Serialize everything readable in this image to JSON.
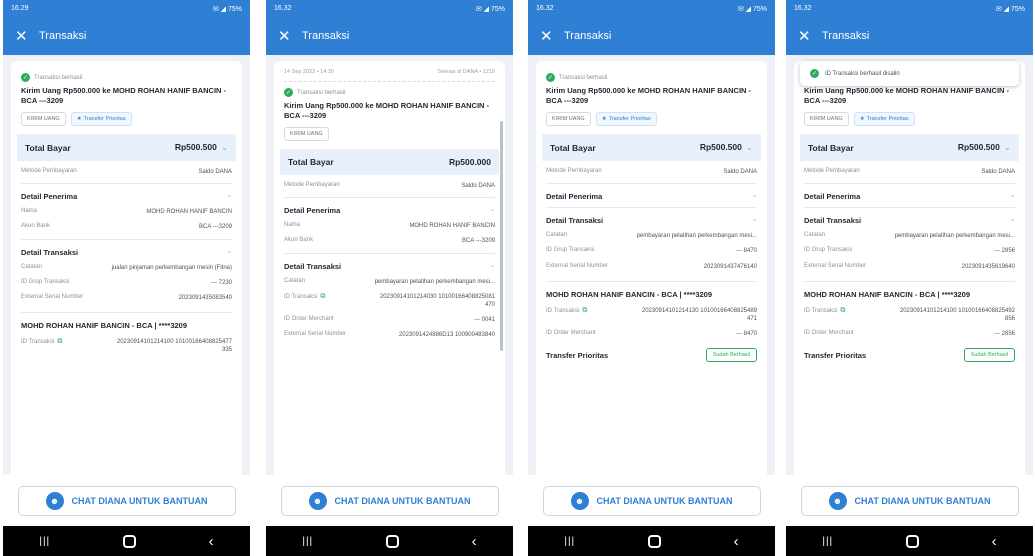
{
  "status": {
    "p1_time": "16.29",
    "p1_right": "✉ ◢ 75%",
    "time": "16.32",
    "right": "✉ ◢ 75%"
  },
  "appbar": {
    "close": "✕",
    "title": "Transaksi"
  },
  "icons": {
    "close": "close-icon",
    "success": "check-circle-icon",
    "star": "star-icon",
    "chevron": "chevron-down-icon",
    "copy": "copy-icon",
    "chat": "chat-support-icon",
    "nav": [
      "recent-apps-icon",
      "home-icon",
      "back-icon"
    ]
  },
  "colors": {
    "brand": "#2f7fd4",
    "success": "#2eab5c",
    "total_bg": "#e7f0fb"
  },
  "glyphs": {
    "ok": "✓",
    "star": "★",
    "chev": "⌄",
    "copy": "⧉",
    "chat": "☻",
    "recent": "|||",
    "back": "‹"
  },
  "p1": {
    "success": "Transaksi berhasil",
    "headline": "Kirim Uang Rp500.000 ke MOHD ROHAN HANIF BANCIN - BCA ---3209",
    "chips": [
      "KIRIM UANG",
      "Transfer Prioritas"
    ],
    "total_label": "Total Bayar",
    "total_value": "Rp500.500",
    "payment_label": "Metode Pembayaran",
    "payment_value": "Saldo DANA",
    "recipient_title": "Detail Penerima",
    "name_label": "Nama",
    "name_value": "MOHD ROHAN HANIF BANCIN",
    "account_label": "Akun Bank",
    "account_value": "BCA ---3209",
    "detail_title": "Detail Transaksi",
    "note_label": "Catatan",
    "note_value": "jualan pinjaman perkembangan mesin (Fitna)",
    "group_label": "ID Grup Transaksi",
    "group_value": "--- 7230",
    "ext_label": "External Serial Number",
    "ext_value": "2023091435083540",
    "recipient_full": "MOHD ROHAN HANIF BANCIN - BCA | ****3209",
    "txid_label": "ID Transaksi",
    "txid_value": "20230914101214100 10100166408825477 335"
  },
  "p2": {
    "date": "14 Sep 2023 • 14:30",
    "ref": "Selesai di DANA • 1219",
    "success": "Transaksi berhasil",
    "headline": "Kirim Uang Rp500.000 ke MOHD ROHAN HANIF BANCIN - BCA ---3209",
    "chip": "KIRIM UANG",
    "total_label": "Total Bayar",
    "total_value": "Rp500.000",
    "payment_label": "Metode Pembayaran",
    "payment_value": "Saldo DANA",
    "recipient_title": "Detail Penerima",
    "name_label": "Nama",
    "name_value": "MOHD ROHAN HANIF BANCIN",
    "account_label": "Akun Bank",
    "account_value": "BCA ---3209",
    "detail_title": "Detail Transaksi",
    "note_label": "Catatan",
    "note_value": "pembayaran pelatihan perkembangan mesi...",
    "txid_label": "ID Transaksi",
    "txid_value": "20230914101214030 10100166408825081 470",
    "order_label": "ID Order Merchant",
    "order_value": "--- 0041",
    "ext_label": "External Serial Number",
    "ext_value": "2023091424886D13 100900483840"
  },
  "p3": {
    "success": "Transaksi berhasil",
    "headline": "Kirim Uang Rp500.000 ke MOHD ROHAN HANIF BANCIN - BCA ---3209",
    "chips": [
      "KIRIM UANG",
      "Transfer Prioritas"
    ],
    "total_label": "Total Bayar",
    "total_value": "Rp500.500",
    "payment_label": "Metode Pembayaran",
    "payment_value": "Saldo DANA",
    "recipient_title": "Detail Penerima",
    "detail_title": "Detail Transaksi",
    "note_label": "Catatan",
    "note_value": "pembayaran pelatihan perkembangan mesi...",
    "group_label": "ID Grup Transaksi",
    "group_value": "--- 8470",
    "ext_label": "External Serial Number",
    "ext_value": "2023091437476140",
    "recipient_full": "MOHD ROHAN HANIF BANCIN - BCA | ****3209",
    "txid_label": "ID Transaksi",
    "txid_value": "20230914101214130 10100166408825489 471",
    "order_label": "ID Order Merchant",
    "order_value": "--- 8470",
    "prio_label": "Transfer Prioritas",
    "prio_button": "Sudah Berhasil"
  },
  "p4": {
    "toast": "ID Transaksi berhasil disalin",
    "headline": "Kirim Uang Rp500.000 ke MOHD ROHAN HANIF BANCIN - BCA ---3209",
    "chips": [
      "KIRIM UANG",
      "Transfer Prioritas"
    ],
    "total_label": "Total Bayar",
    "total_value": "Rp500.500",
    "payment_label": "Metode Pembayaran",
    "payment_value": "Saldo DANA",
    "recipient_title": "Detail Penerima",
    "detail_title": "Detail Transaksi",
    "note_label": "Catatan",
    "note_value": "pembayaran pelatihan perkembangan mesi...",
    "group_label": "ID Grup Transaksi",
    "group_value": "--- 2856",
    "ext_label": "External Serial Number",
    "ext_value": "2023091435619640",
    "recipient_full": "MOHD ROHAN HANIF BANCIN - BCA | ****3209",
    "txid_label": "ID Transaksi",
    "txid_value": "20230914101214100 10100166408825492 856",
    "order_label": "ID Order Merchant",
    "order_value": "--- 2856",
    "prio_label": "Transfer Prioritas",
    "prio_button": "Sudah Berhasil"
  },
  "chat_button": "CHAT DIANA UNTUK BANTUAN"
}
